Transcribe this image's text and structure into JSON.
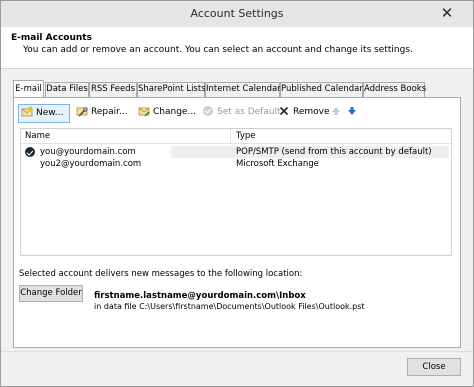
{
  "window": {
    "title": "Account Settings"
  },
  "header": {
    "heading": "E-mail Accounts",
    "description": "You can add or remove an account. You can select an account and change its settings."
  },
  "tabs": [
    {
      "label": "E-mail",
      "active": true
    },
    {
      "label": "Data Files"
    },
    {
      "label": "RSS Feeds"
    },
    {
      "label": "SharePoint Lists"
    },
    {
      "label": "Internet Calendars"
    },
    {
      "label": "Published Calendars"
    },
    {
      "label": "Address Books"
    }
  ],
  "toolbar": {
    "new_label": "New...",
    "repair_label": "Repair...",
    "change_label": "Change...",
    "set_default_label": "Set as Default",
    "remove_label": "Remove"
  },
  "accounts": {
    "col_name": "Name",
    "col_type": "Type",
    "rows": [
      {
        "name": "you@yourdomain.com",
        "type": "POP/SMTP (send from this account by default)",
        "default": true
      },
      {
        "name": "you2@yourdomain.com",
        "type": "Microsoft Exchange",
        "default": false
      }
    ]
  },
  "delivery": {
    "text": "Selected account delivers new messages to the following location:",
    "change_folder_label": "Change Folder",
    "location": "firstname.lastname@yourdomain.com\\Inbox",
    "data_file": "in data file C:\\Users\\firstname\\Documents\\Outlook  Files\\Outlook.pst"
  },
  "footer": {
    "close_label": "Close"
  },
  "colors": {
    "selection_border": "#7eb4ea",
    "selection_fill": "#e5f1fb",
    "arrow_blue": "#2a6ad3"
  }
}
